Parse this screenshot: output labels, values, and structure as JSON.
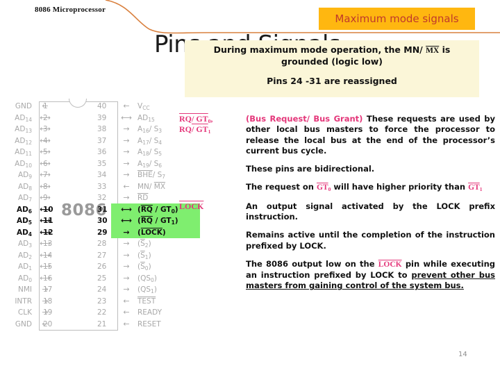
{
  "header": {
    "course_title": "8086 Microprocessor",
    "page_title": "Pins and Signals",
    "page_number": "14"
  },
  "banner": {
    "label": "Maximum mode signals",
    "bg_color": "#FFB710",
    "text_color": "#C0392B"
  },
  "note": {
    "bg_color": "#FBF6D8",
    "line1_a": "During maximum mode operation, the MN/ ",
    "line1_b": "MX",
    "line1_c": " is",
    "line1_d": "grounded (logic low)",
    "line2": "Pins 24 -31 are reassigned"
  },
  "chip": {
    "name": "8086",
    "highlight_color": "#7FEE6F",
    "left_pins": [
      {
        "num": "1",
        "label": "GND",
        "sub": "",
        "arrow": "←"
      },
      {
        "num": "2",
        "label": "AD",
        "sub": "14",
        "arrow": "⟷"
      },
      {
        "num": "3",
        "label": "AD",
        "sub": "13",
        "arrow": "⟷"
      },
      {
        "num": "4",
        "label": "AD",
        "sub": "12",
        "arrow": "⟷"
      },
      {
        "num": "5",
        "label": "AD",
        "sub": "11",
        "arrow": "⟷"
      },
      {
        "num": "6",
        "label": "AD",
        "sub": "10",
        "arrow": "⟷"
      },
      {
        "num": "7",
        "label": "AD",
        "sub": "9",
        "arrow": "⟷"
      },
      {
        "num": "8",
        "label": "AD",
        "sub": "8",
        "arrow": "⟷"
      },
      {
        "num": "9",
        "label": "AD",
        "sub": "7",
        "arrow": "⟷"
      },
      {
        "num": "10",
        "label": "AD",
        "sub": "6",
        "arrow": "⟷"
      },
      {
        "num": "11",
        "label": "AD",
        "sub": "5",
        "arrow": "⟷"
      },
      {
        "num": "12",
        "label": "AD",
        "sub": "4",
        "arrow": "⟷"
      },
      {
        "num": "13",
        "label": "AD",
        "sub": "3",
        "arrow": "⟷"
      },
      {
        "num": "14",
        "label": "AD",
        "sub": "2",
        "arrow": "⟷"
      },
      {
        "num": "15",
        "label": "AD",
        "sub": "1",
        "arrow": "⟷"
      },
      {
        "num": "16",
        "label": "AD",
        "sub": "0",
        "arrow": "⟷"
      },
      {
        "num": "17",
        "label": "NMI",
        "sub": "",
        "arrow": "→"
      },
      {
        "num": "18",
        "label": "INTR",
        "sub": "",
        "arrow": "→"
      },
      {
        "num": "19",
        "label": "CLK",
        "sub": "",
        "arrow": "→"
      },
      {
        "num": "20",
        "label": "GND",
        "sub": "",
        "arrow": "←"
      }
    ],
    "right_pins": [
      {
        "num": "40",
        "label": "V",
        "sub": "CC",
        "arrow": "←",
        "bar": false,
        "hl": false
      },
      {
        "num": "39",
        "label": "AD",
        "sub": "15",
        "arrow": "⟷",
        "bar": false,
        "hl": false
      },
      {
        "num": "38",
        "label": "A",
        "sub": "16",
        "arrow": "→",
        "bar": false,
        "hl": false,
        "suffix": "/ S",
        "suffix_sub": "3"
      },
      {
        "num": "37",
        "label": "A",
        "sub": "17",
        "arrow": "→",
        "bar": false,
        "hl": false,
        "suffix": "/ S",
        "suffix_sub": "4"
      },
      {
        "num": "36",
        "label": "A",
        "sub": "18",
        "arrow": "→",
        "bar": false,
        "hl": false,
        "suffix": "/ S",
        "suffix_sub": "5"
      },
      {
        "num": "35",
        "label": "A",
        "sub": "19",
        "arrow": "→",
        "bar": false,
        "hl": false,
        "suffix": "/ S",
        "suffix_sub": "6"
      },
      {
        "num": "34",
        "label": "BHE",
        "sub": "",
        "arrow": "→",
        "bar": true,
        "hl": false,
        "suffix": "/ S",
        "suffix_sub": "7"
      },
      {
        "num": "33",
        "label": "MN/ MX",
        "sub": "",
        "arrow": "←",
        "bar": false,
        "hl": false
      },
      {
        "num": "32",
        "label": "RD",
        "sub": "",
        "arrow": "→",
        "bar": true,
        "hl": false
      },
      {
        "num": "31",
        "label": "(RQ / GT",
        "sub": "0",
        "arrow": "⟷",
        "bar": true,
        "hl": true,
        "suffix": ")"
      },
      {
        "num": "30",
        "label": "(RQ / GT",
        "sub": "1",
        "arrow": "⟷",
        "bar": true,
        "hl": true,
        "suffix": ")"
      },
      {
        "num": "29",
        "label": "(LOCK)",
        "sub": "",
        "arrow": "→",
        "bar": true,
        "hl": true
      },
      {
        "num": "28",
        "label": "(S",
        "sub": "2",
        "arrow": "→",
        "bar": true,
        "hl": false,
        "suffix": ")"
      },
      {
        "num": "27",
        "label": "(S",
        "sub": "1",
        "arrow": "→",
        "bar": true,
        "hl": false,
        "suffix": ")"
      },
      {
        "num": "26",
        "label": "(S",
        "sub": "0",
        "arrow": "→",
        "bar": true,
        "hl": false,
        "suffix": ")"
      },
      {
        "num": "25",
        "label": "(QS",
        "sub": "0",
        "arrow": "→",
        "bar": false,
        "hl": false,
        "suffix": ")"
      },
      {
        "num": "24",
        "label": "(QS",
        "sub": "1",
        "arrow": "→",
        "bar": false,
        "hl": false,
        "suffix": ")"
      },
      {
        "num": "23",
        "label": "TEST",
        "sub": "",
        "arrow": "←",
        "bar": true,
        "hl": false
      },
      {
        "num": "22",
        "label": "READY",
        "sub": "",
        "arrow": "←",
        "bar": false,
        "hl": false
      },
      {
        "num": "21",
        "label": "RESET",
        "sub": "",
        "arrow": "←",
        "bar": false,
        "hl": false
      }
    ]
  },
  "descriptions": {
    "rq_gt": {
      "signal_line1_a": "RQ",
      "signal_line1_b": "/ GT",
      "signal_line1_sub": "0",
      "signal_line1_c": ",",
      "signal_line2_a": "RQ",
      "signal_line2_b": "/ GT",
      "signal_line2_sub": "1",
      "para1_pink": "(Bus Request/ Bus Grant)",
      "para1_rest": " These requests are used by other local bus masters to force the processor to release the local bus at the end of the processor’s current bus cycle.",
      "para2": "These pins are bidirectional.",
      "para3_a": "The request on ",
      "para3_pink": "GT",
      "para3_pink_sub": "0",
      "para3_b": " will have higher priority than ",
      "para3_pink2": "GT",
      "para3_pink2_sub": "1"
    },
    "lock": {
      "signal": "LOCK",
      "para1": "An output signal activated by the LOCK prefix instruction.",
      "para2": "Remains active until the completion of the instruction prefixed by LOCK.",
      "para3_a": "The 8086 output low on the ",
      "para3_pink": "LOCK",
      "para3_b": " pin while executing an instruction prefixed by LOCK to ",
      "para3_underlined": "prevent other bus masters from gaining control of the system bus."
    }
  }
}
